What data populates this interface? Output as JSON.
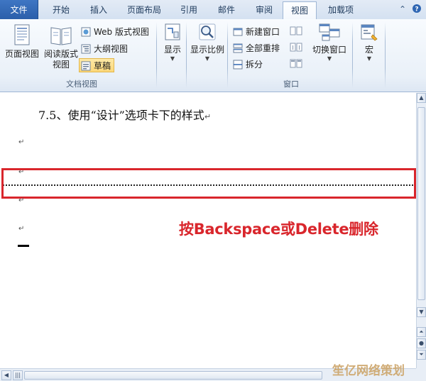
{
  "tabs": [
    {
      "label": "文件"
    },
    {
      "label": "开始"
    },
    {
      "label": "插入"
    },
    {
      "label": "页面布局"
    },
    {
      "label": "引用"
    },
    {
      "label": "邮件"
    },
    {
      "label": "审阅"
    },
    {
      "label": "视图"
    },
    {
      "label": "加载项"
    }
  ],
  "active_tab": "视图",
  "ribbon": {
    "doc_views": {
      "group_label": "文档视图",
      "print_layout": "页面视图",
      "reading_layout_line1": "阅读版式",
      "reading_layout_line2": "视图",
      "web_layout": "Web 版式视图",
      "outline": "大纲视图",
      "draft": "草稿"
    },
    "show": {
      "label": "显示"
    },
    "zoom": {
      "label": "显示比例"
    },
    "window": {
      "group_label": "窗口",
      "new_window": "新建窗口",
      "arrange_all": "全部重排",
      "split": "拆分",
      "switch_windows": "切换窗口"
    },
    "macros": {
      "label": "宏"
    }
  },
  "document": {
    "heading": "7.5、使用“设计”选项卡下的样式",
    "paragraph_mark": "↵",
    "annotation": "按Backspace或Delete删除"
  },
  "watermark": "笙亿网络策划",
  "colors": {
    "highlight_border": "#d9262c",
    "annotation_text": "#d9262c",
    "file_tab": "#2f66b3"
  }
}
